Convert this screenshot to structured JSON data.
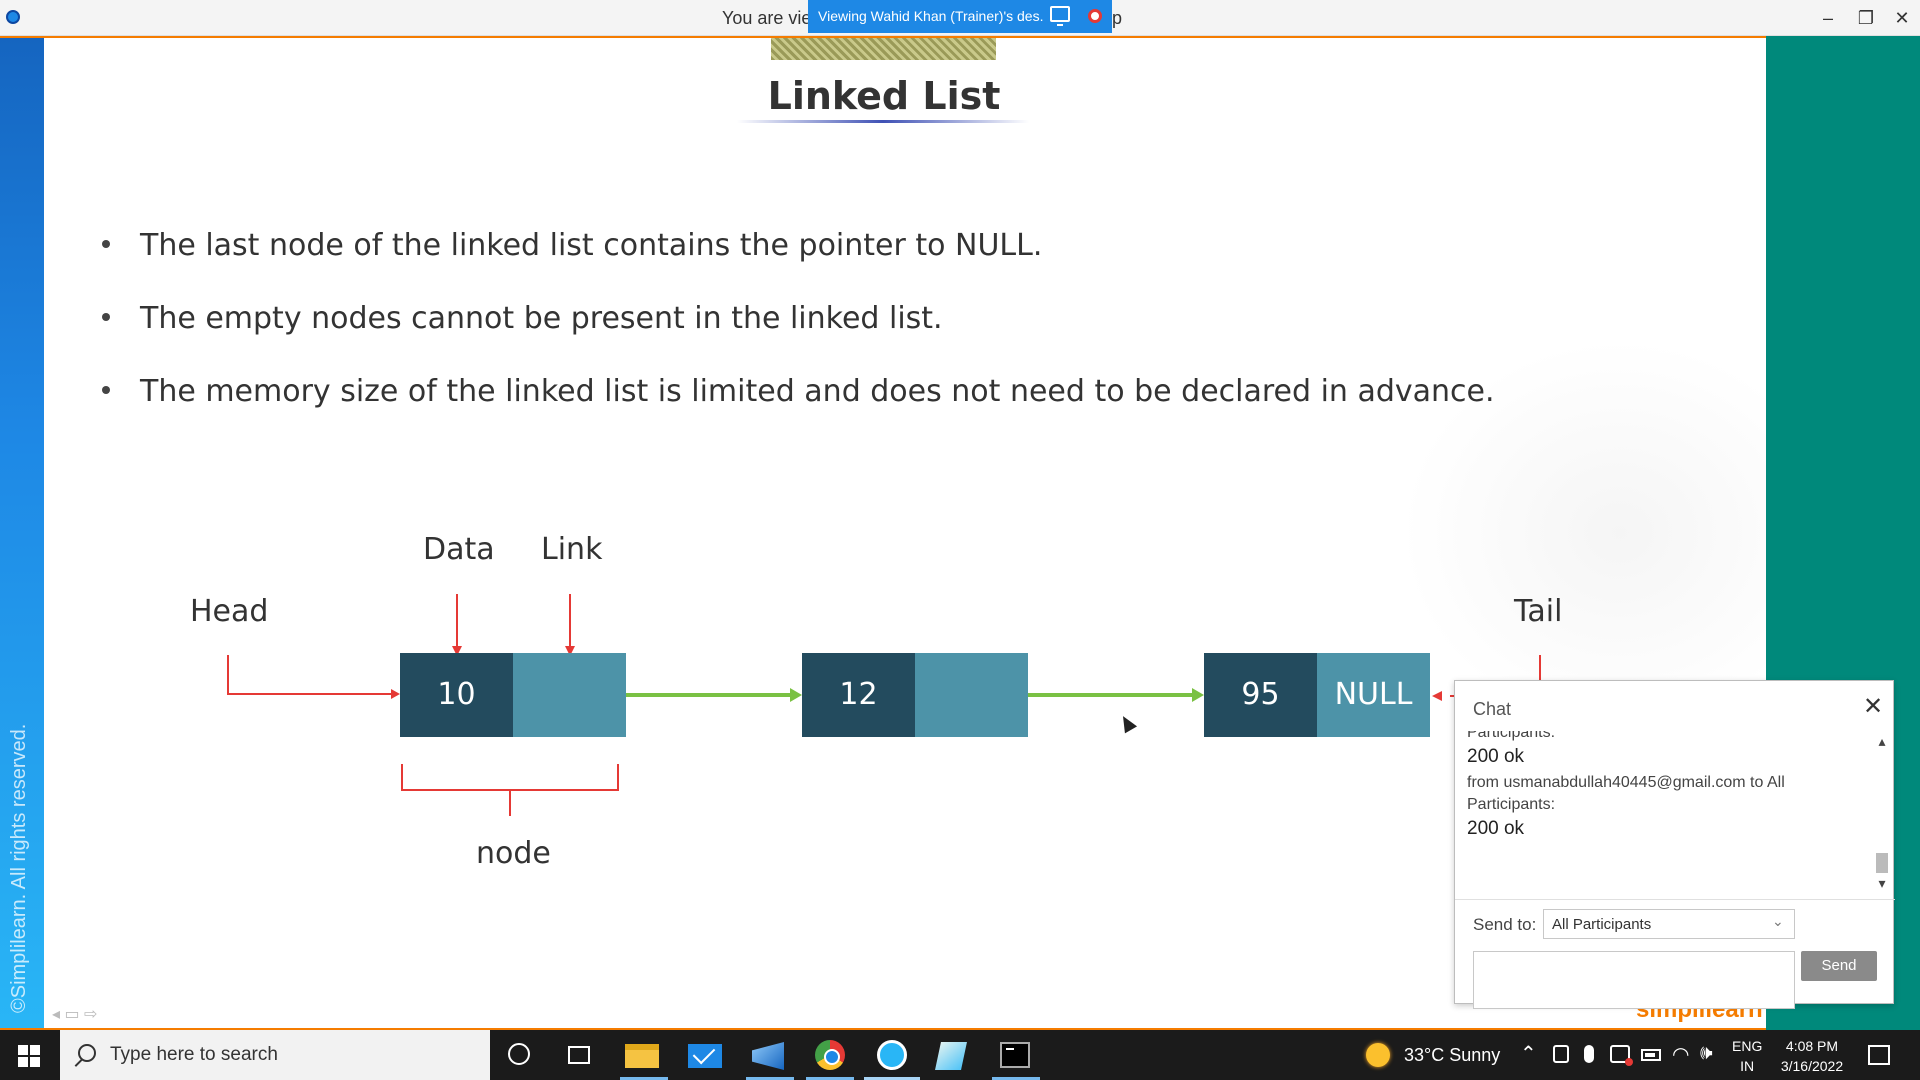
{
  "titlebar": {
    "title_visible": "You are vie",
    "viewing_banner": "Viewing Wahid Khan (Trainer)'s des...",
    "title_tail": "p",
    "minimize": "–",
    "restore": "❐",
    "close": "✕"
  },
  "slide": {
    "title": "Linked List",
    "bullets": [
      "The last node of the linked list contains the pointer to NULL.",
      "The empty nodes cannot be present in the linked list.",
      "The memory size of the linked list is limited and does not need to be declared in advance."
    ],
    "diagram": {
      "head_label": "Head",
      "tail_label": "Tail",
      "data_label": "Data",
      "link_label": "Link",
      "node_label": "node",
      "nodes": [
        {
          "data": "10",
          "link": ""
        },
        {
          "data": "12",
          "link": ""
        },
        {
          "data": "95",
          "link": "NULL"
        }
      ],
      "colors": {
        "data_cell": "#234b5e",
        "link_cell": "#4d93a8",
        "arrow": "#7ac143",
        "pointer": "#e53935"
      }
    },
    "copyright": "©Simplilearn. All rights reserved.",
    "brand": "simplilearn"
  },
  "chat": {
    "title": "Chat",
    "close": "✕",
    "messages": [
      {
        "from_tail": "Participants:",
        "body": "200 ok"
      },
      {
        "from": "from usmanabdullah40445@gmail.com to All",
        "from_tail": "Participants:",
        "body": "200 ok"
      }
    ],
    "send_to_label": "Send to:",
    "send_to_value": "All Participants",
    "send_button": "Send"
  },
  "taskbar": {
    "search_placeholder": "Type here to search",
    "weather": "33°C  Sunny",
    "lang_line1": "ENG",
    "lang_line2": "IN",
    "time": "4:08 PM",
    "date": "3/16/2022"
  }
}
